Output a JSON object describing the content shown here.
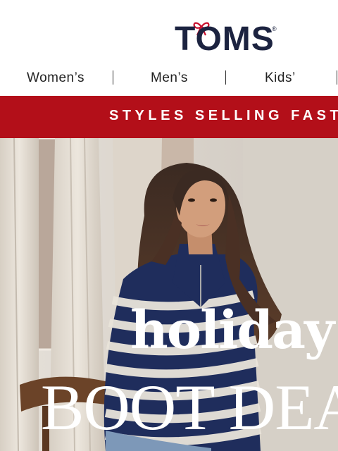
{
  "brand": {
    "name": "TOMS",
    "registered": "®"
  },
  "nav": {
    "items": [
      "Women’s",
      "Men’s",
      "Kids’"
    ]
  },
  "banner": {
    "text": "STYLES SELLING FAST",
    "color": "#b30f19"
  },
  "hero": {
    "line1": "holiday",
    "line2": "BOOT DEALS"
  },
  "colors": {
    "brand_navy": "#1c2340",
    "accent_red": "#b30f19"
  }
}
